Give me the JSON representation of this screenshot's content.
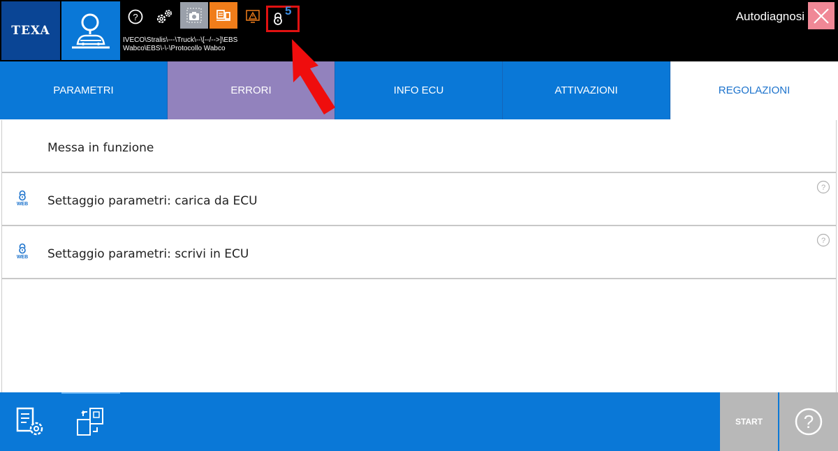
{
  "topbar": {
    "logo_text": "TEXA",
    "path_line1": "IVECO\\Stralis\\---\\Truck\\--\\[--/-->]\\EBS",
    "path_line2": "Wabco\\EBS\\-\\-\\Protocollo Wabco",
    "mode_title": "Autodiagnosi",
    "lock_count": "5",
    "icons": [
      "diagnosis-search-icon",
      "help-icon",
      "gears-icon",
      "camera-icon",
      "device-icon",
      "warning-icon",
      "lock-icon",
      "close-icon"
    ]
  },
  "tabs": [
    {
      "label": "PARAMETRI",
      "state": "normal"
    },
    {
      "label": "ERRORI",
      "state": "highlighted"
    },
    {
      "label": "INFO ECU",
      "state": "normal"
    },
    {
      "label": "ATTIVAZIONI",
      "state": "normal"
    },
    {
      "label": "REGOLAZIONI",
      "state": "active"
    }
  ],
  "rows": [
    {
      "label": "Messa in funzione",
      "locked": false
    },
    {
      "label": "Settaggio parametri: carica da ECU",
      "locked": true,
      "badge": "WEB"
    },
    {
      "label": "Settaggio parametri: scrivi in ECU",
      "locked": true,
      "badge": "WEB"
    }
  ],
  "bottombar": {
    "start_label": "START"
  },
  "colors": {
    "primary_blue": "#0a78d7",
    "logo_blue": "#0a4595",
    "tab_highlight": "#9282bd",
    "orange": "#f07d1a",
    "close_pink": "#f08896",
    "alert_red": "#e01111",
    "disabled_gray": "#b8b8b8"
  }
}
